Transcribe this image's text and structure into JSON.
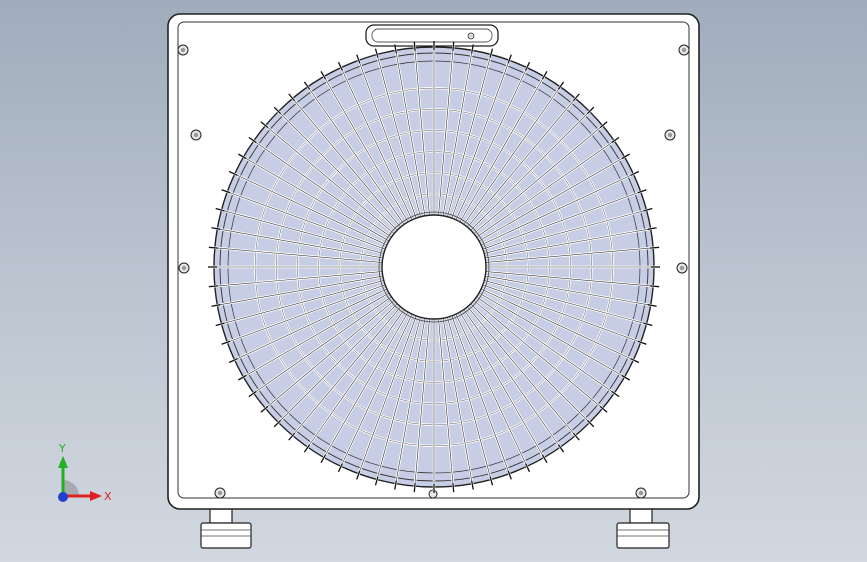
{
  "view": {
    "background_top": "#a0acbc",
    "background_bottom": "#d2d8e0",
    "part_fill": "#ffffff",
    "outline": "#222222",
    "grille_shade": "#c7cde4"
  },
  "model": {
    "name": "",
    "grille": {
      "spokes": 72,
      "rings": 6
    },
    "screws": 8,
    "feet": 2
  },
  "triad": {
    "x_label": "X",
    "y_label": "Y",
    "x_color": "#e02020",
    "y_color": "#20b020",
    "z_color": "#2040d0"
  }
}
